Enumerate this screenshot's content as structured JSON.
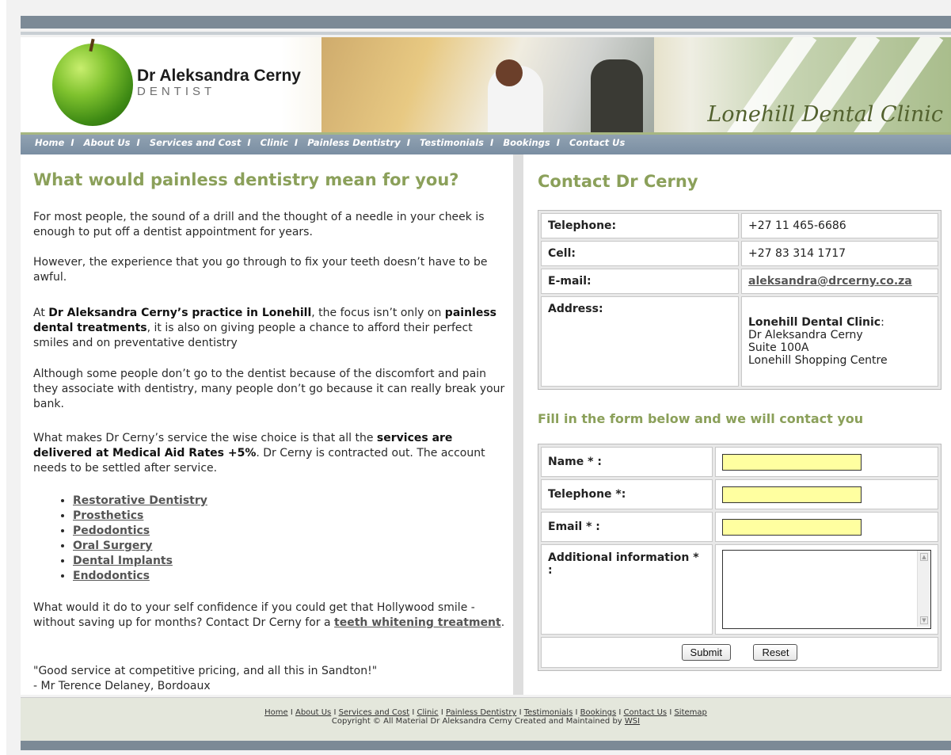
{
  "header": {
    "doctor_name": "Dr Aleksandra Cerny",
    "doctor_title": "DENTIST",
    "clinic_name": "Lonehill Dental Clinic"
  },
  "nav": {
    "items": [
      {
        "label": "Home"
      },
      {
        "label": "About Us"
      },
      {
        "label": "Services and Cost"
      },
      {
        "label": "Clinic"
      },
      {
        "label": "Painless Dentistry"
      },
      {
        "label": "Testimonials"
      },
      {
        "label": "Bookings"
      },
      {
        "label": "Contact Us"
      }
    ],
    "separator": "I"
  },
  "left": {
    "heading": "What would painless dentistry mean for you?",
    "p1": "For most people, the sound of a drill and the thought of a needle in your cheek is enough to put off a dentist appointment for years.",
    "p2": "However, the experience that you go through to fix your teeth doesn’t have to be awful.",
    "p3_a": "At ",
    "p3_bold1": "Dr Aleksandra Cerny’s practice in Lonehill",
    "p3_b": ", the focus isn’t only on ",
    "p3_bold2": "painless dental treatments",
    "p3_c": ", it is also on giving people a chance to afford their perfect smiles and on preventative dentistry",
    "p4": "Although some people don’t go to the dentist because of the discomfort and pain they associate with dentistry, many people don’t go because it can really break your bank.",
    "p5_a": "What makes Dr Cerny’s service the wise choice is that all the ",
    "p5_bold": "services are delivered at Medical Aid Rates +5%",
    "p5_b": ". Dr Cerny is contracted out. The account needs to be settled after service.",
    "services": [
      "Restorative Dentistry",
      "Prosthetics",
      "Pedodontics",
      "Oral Surgery",
      "Dental Implants",
      "Endodontics"
    ],
    "p6_a": "What would it do to your self confidence if you could get that Hollywood smile - without saving up for months? Contact Dr Cerny for a ",
    "p6_link": "teeth whitening treatment",
    "p6_b": ".",
    "quote": "\"Good service at competitive pricing, and all this in Sandton!\"",
    "quote_author": "- Mr Terence Delaney, Bordoaux"
  },
  "contact": {
    "heading": "Contact Dr Cerny",
    "telephone_label": "Telephone:",
    "telephone": "+27 11 465-6686",
    "cell_label": "Cell:",
    "cell": "+27 83 314 1717",
    "email_label": "E-mail:",
    "email": "aleksandra@drcerny.co.za",
    "address_label": "Address:",
    "address_name": "Lonehill Dental Clinic",
    "address_colon": ":",
    "address_line1": "Dr Aleksandra Cerny",
    "address_line2": "Suite 100A",
    "address_line3": "Lonehill Shopping Centre"
  },
  "form": {
    "heading": "Fill in the form below and we will contact you",
    "name_label": "Name * :",
    "telephone_label": "Telephone *:",
    "email_label": "Email * :",
    "info_label": "Additional information * :",
    "submit": "Submit",
    "reset": "Reset",
    "field_color": "#ffffa0"
  },
  "footer": {
    "links": [
      "Home",
      "About Us",
      "Services and Cost",
      "Clinic",
      "Painless Dentistry",
      "Testimonials",
      "Bookings",
      "Contact Us",
      "Sitemap"
    ],
    "copyright": "Copyright © All Material Dr Aleksandra Cerny   Created and Maintained by ",
    "wsi": "WSI"
  },
  "colors": {
    "accent_green": "#8ba05a",
    "nav_blue": "#7a8ea2",
    "bar_gray": "#7c8a96"
  }
}
